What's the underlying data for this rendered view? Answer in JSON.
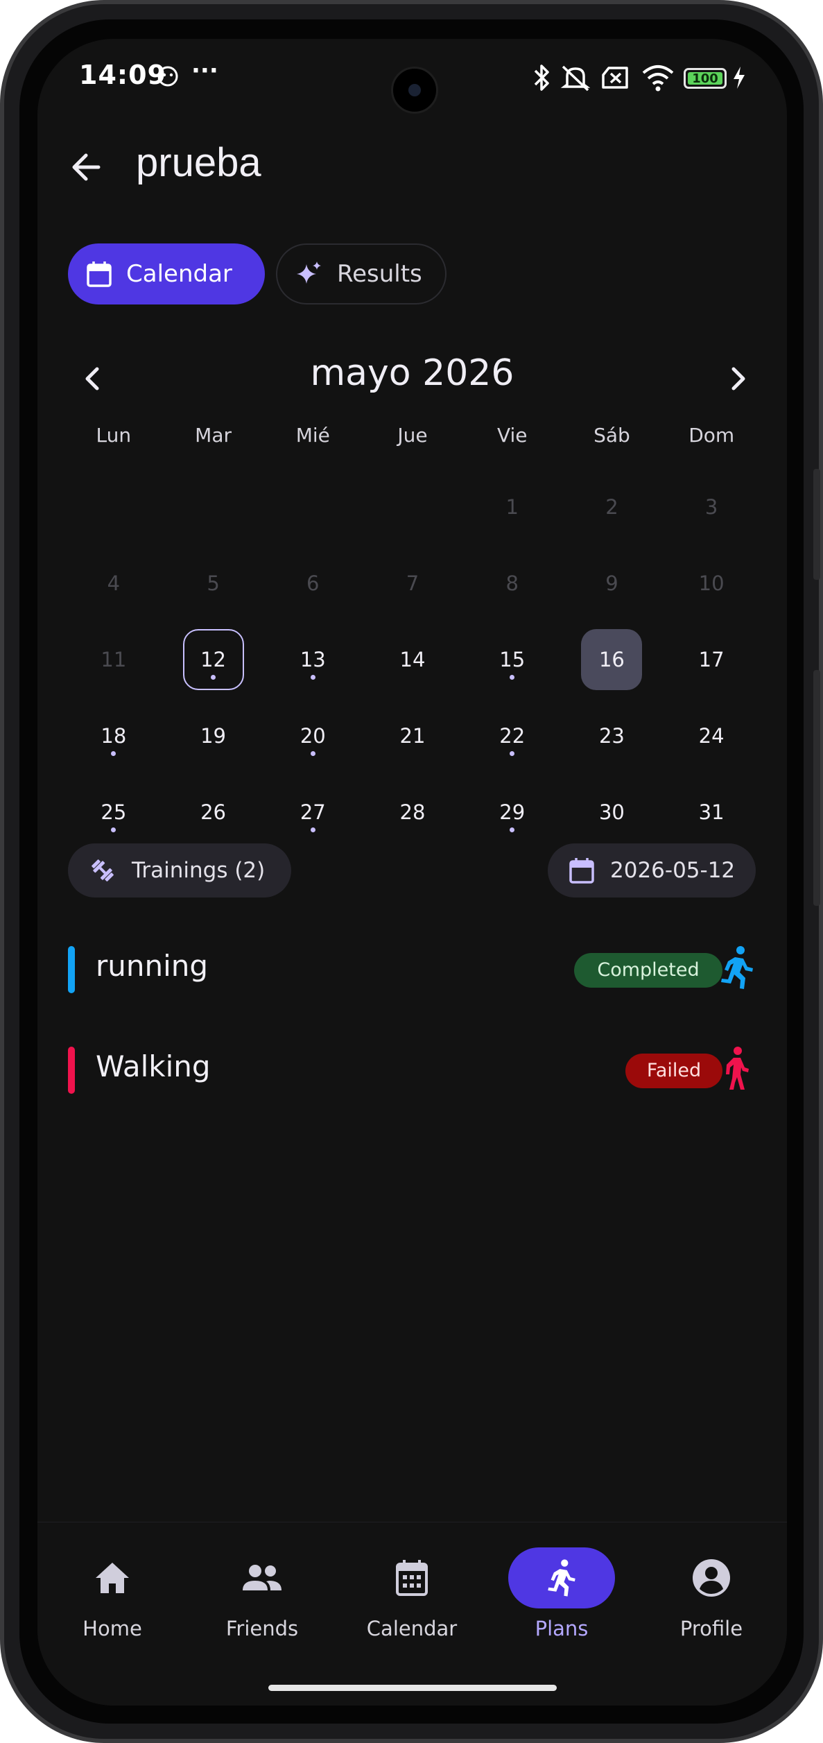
{
  "status_bar": {
    "time": "14:09",
    "more": "···",
    "battery": "100"
  },
  "header": {
    "title": "prueba"
  },
  "tabs": [
    {
      "label": "Calendar",
      "icon": "calendar-icon",
      "active": true
    },
    {
      "label": "Results",
      "icon": "sparkle-icon",
      "active": false
    }
  ],
  "calendar": {
    "month_label": "mayo 2026",
    "weekdays": [
      "Lun",
      "Mar",
      "Mié",
      "Jue",
      "Vie",
      "Sáb",
      "Dom"
    ],
    "days": [
      {
        "n": "",
        "state": "empty"
      },
      {
        "n": "",
        "state": "empty"
      },
      {
        "n": "",
        "state": "empty"
      },
      {
        "n": "",
        "state": "empty"
      },
      {
        "n": "1",
        "state": "disabled"
      },
      {
        "n": "2",
        "state": "disabled"
      },
      {
        "n": "3",
        "state": "disabled"
      },
      {
        "n": "4",
        "state": "disabled"
      },
      {
        "n": "5",
        "state": "disabled"
      },
      {
        "n": "6",
        "state": "disabled"
      },
      {
        "n": "7",
        "state": "disabled"
      },
      {
        "n": "8",
        "state": "disabled"
      },
      {
        "n": "9",
        "state": "disabled"
      },
      {
        "n": "10",
        "state": "disabled"
      },
      {
        "n": "11",
        "state": "disabled"
      },
      {
        "n": "12",
        "state": "today",
        "dot": true
      },
      {
        "n": "13",
        "state": "normal",
        "dot": true
      },
      {
        "n": "14",
        "state": "normal"
      },
      {
        "n": "15",
        "state": "normal",
        "dot": true
      },
      {
        "n": "16",
        "state": "selected"
      },
      {
        "n": "17",
        "state": "normal"
      },
      {
        "n": "18",
        "state": "normal",
        "dot": true
      },
      {
        "n": "19",
        "state": "normal"
      },
      {
        "n": "20",
        "state": "normal",
        "dot": true
      },
      {
        "n": "21",
        "state": "normal"
      },
      {
        "n": "22",
        "state": "normal",
        "dot": true
      },
      {
        "n": "23",
        "state": "normal"
      },
      {
        "n": "24",
        "state": "normal"
      },
      {
        "n": "25",
        "state": "normal",
        "dot": true
      },
      {
        "n": "26",
        "state": "normal"
      },
      {
        "n": "27",
        "state": "normal",
        "dot": true
      },
      {
        "n": "28",
        "state": "normal"
      },
      {
        "n": "29",
        "state": "normal",
        "dot": true
      },
      {
        "n": "30",
        "state": "normal"
      },
      {
        "n": "31",
        "state": "normal"
      }
    ]
  },
  "chips": {
    "trainings": "Trainings (2)",
    "date": "2026-05-12"
  },
  "trainings": [
    {
      "name": "running",
      "status": "Completed",
      "bar_color": "#12a3f5",
      "status_bg": "#1e5a30",
      "status_fg": "#d9f3dd",
      "icon_color": "#12a3f5"
    },
    {
      "name": "Walking",
      "status": "Failed",
      "bar_color": "#f0134d",
      "status_bg": "#9b0a0a",
      "status_fg": "#ffe0e0",
      "icon_color": "#f0134d"
    }
  ],
  "bottom_nav": [
    {
      "label": "Home",
      "icon": "home-icon",
      "active": false
    },
    {
      "label": "Friends",
      "icon": "friends-icon",
      "active": false
    },
    {
      "label": "Calendar",
      "icon": "calendar-icon",
      "active": false
    },
    {
      "label": "Plans",
      "icon": "runner-icon",
      "active": true
    },
    {
      "label": "Profile",
      "icon": "profile-icon",
      "active": false
    }
  ],
  "colors": {
    "accent": "#4f37e3",
    "background": "#121212"
  }
}
